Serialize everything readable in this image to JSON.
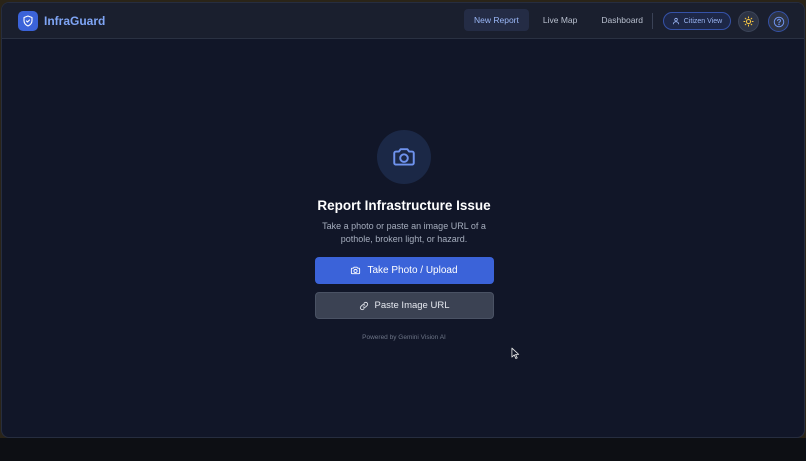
{
  "app": {
    "name": "InfraGuard",
    "brand_color": "#7fa5f5",
    "accent_color": "#3b63d9"
  },
  "nav": {
    "links": [
      {
        "label": "New Report",
        "active": true
      },
      {
        "label": "Live Map",
        "active": false
      },
      {
        "label": "Dashboard",
        "active": false
      }
    ],
    "citizen_view_label": "Citizen View",
    "icons": [
      "shield-icon",
      "user-icon",
      "sun-icon",
      "help-icon"
    ]
  },
  "main": {
    "title": "Report Infrastructure Issue",
    "subtitle": "Take a photo or paste an image URL of a pothole, broken light, or hazard.",
    "primary_button": "Take Photo / Upload",
    "secondary_button": "Paste Image URL",
    "footer": "Powered by Gemini Vision AI",
    "icons": [
      "camera-icon",
      "link-icon"
    ]
  }
}
